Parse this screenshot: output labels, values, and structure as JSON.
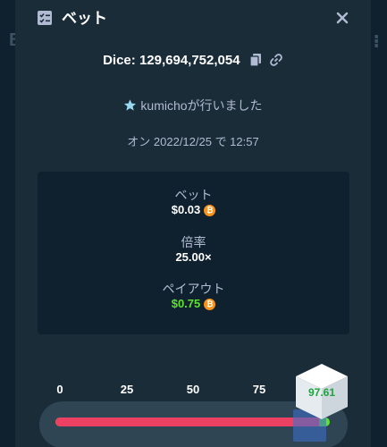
{
  "header": {
    "title": "ベット",
    "icon": "receipt-icon",
    "close_icon": "close-icon"
  },
  "game": {
    "label": "Dice: 129,694,752,054",
    "copy_icon": "copy-icon",
    "link_icon": "link-icon"
  },
  "user": {
    "name": "kumicho",
    "suffix": "が行いました",
    "icon": "star-icon"
  },
  "date": {
    "text": "オン 2022/12/25 で 12:57"
  },
  "stats": {
    "bet_label": "ベット",
    "bet_value": "$0.03",
    "multiplier_label": "倍率",
    "multiplier_value": "25.00×",
    "payout_label": "ペイアウト",
    "payout_value": "$0.75",
    "currency_icon": "bitcoin-icon"
  },
  "slider": {
    "ticks": [
      "0",
      "25",
      "50",
      "75"
    ],
    "roll_over": 96.0,
    "result": "97.61",
    "result_value": 97.61
  },
  "colors": {
    "modal_bg": "#1a2c38",
    "panel_bg": "#0f212e",
    "win_green": "#5ee22f",
    "lose_red": "#ed4163",
    "muted_text": "#b1bad3",
    "coin_orange": "#f7931a"
  }
}
